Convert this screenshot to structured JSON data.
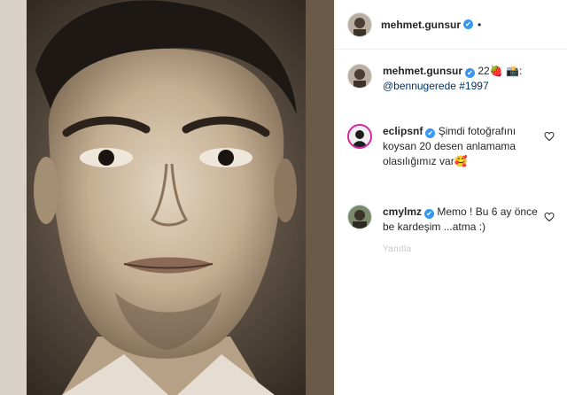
{
  "post": {
    "photo_alt": "portrait-photo"
  },
  "header": {
    "username": "mehmet.gunsur",
    "verified": "✔",
    "more": "•"
  },
  "caption": {
    "username": "mehmet.gunsur",
    "text_prefix": " 22",
    "strawberry": "🍓",
    "camera": "📸",
    "colon": ":",
    "mention": "@bennugerede",
    "hashtag": " #1997"
  },
  "comments": [
    {
      "username": "eclipsnf",
      "text": "Şimdi fotoğrafını koysan 20 desen anlamama olasılığımız var",
      "emoji": "🥰"
    },
    {
      "username": "cmylmz",
      "text": "Memo ! Bu 6 ay önce be kardeşim ...atma :)",
      "meta": "Yanıtla"
    }
  ],
  "colors": {
    "verified": "#3897f0",
    "link": "#003569",
    "text": "#262626"
  }
}
